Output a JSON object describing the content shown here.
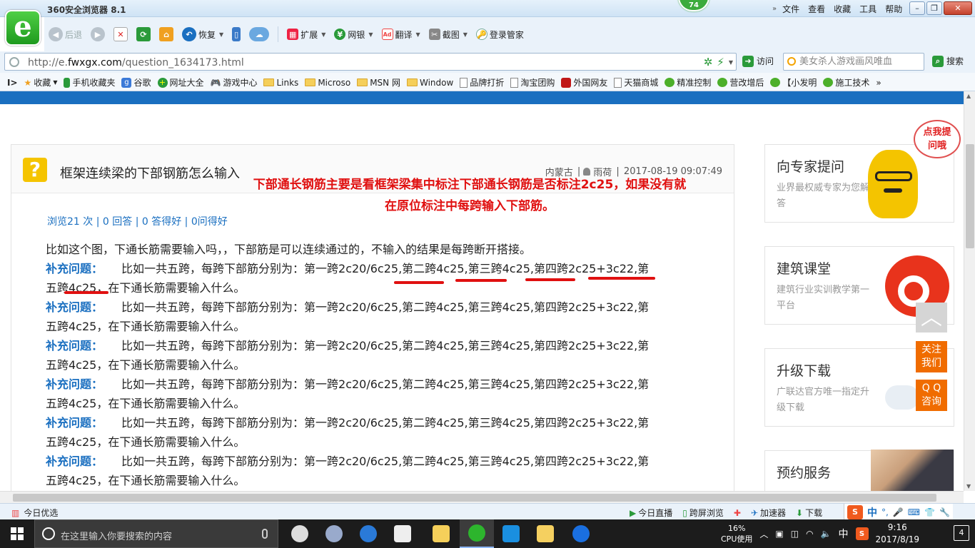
{
  "browser": {
    "title": "360安全浏览器 8.1",
    "badge": "74",
    "menu": [
      "文件",
      "查看",
      "收藏",
      "工具",
      "帮助"
    ],
    "logo_glyph": "e"
  },
  "toolbar": {
    "back": "后退",
    "restore": "恢复",
    "extend": "扩展",
    "netbank": "网银",
    "translate": "翻译",
    "screenshot": "截图",
    "login": "登录管家"
  },
  "address": {
    "url_prefix": "http://e.",
    "url_domain": "fwxgx.com",
    "url_path": "/question_1634173.html",
    "visit": "访问",
    "search_placeholder": "美女杀人游戏画风唯血",
    "search_button": "搜索"
  },
  "favorites": [
    "收藏",
    "手机收藏夹",
    "谷歌",
    "网址大全",
    "游戏中心",
    "Links",
    "Microso",
    "MSN 网",
    "Window",
    "品牌打折",
    "淘宝团购",
    "外国网友",
    "天猫商城",
    "精准控制",
    "营改增后",
    "【小发明",
    "施工技术"
  ],
  "question": {
    "icon": "?",
    "title": "框架连续梁的下部钢筋怎么输入",
    "region": "内蒙古",
    "author": "雨荷",
    "datetime": "2017-08-19 09:07:49",
    "stats": "浏览21 次 | 0 回答 | 0 答得好 | 0问得好",
    "body": "比如这个图，下通长筋需要输入吗，，下部筋是可以连续通过的，不输入的结果是每跨断开搭接。",
    "supplement_label": "补充问题：",
    "supplement_line1": "比如一共五跨，每跨下部筋分别为：第一跨2c20/6c25,第二跨4c25,第三跨4c25,第四跨2c25+3c22,第",
    "supplement_line2": "五跨4c25，在下通长筋需要输入什么。",
    "annotation_line1": "下部通长钢筋主要是看框架梁集中标注下部通长钢筋是否标注2c25，如果没有就",
    "annotation_line2": "在原位标注中每跨输入下部筋。"
  },
  "sidebar": {
    "expert_title": "向专家提问",
    "expert_sub": "业界最权威专家为您解答",
    "speech": "点我提问哦",
    "class_title": "建筑课堂",
    "class_sub": "建筑行业实训教学第一平台",
    "upgrade_title": "升级下载",
    "upgrade_sub": "广联达官方唯一指定升级下载",
    "booking_title": "预约服务",
    "follow": "关注我们",
    "qq": "Q Q咨询"
  },
  "statusbar": {
    "today": "今日优选",
    "live": "今日直播",
    "screen": "跨屏浏览",
    "accel": "加速器",
    "download": "下载",
    "ime": "中"
  },
  "taskbar": {
    "search_placeholder": "在这里输入你要搜索的内容",
    "cpu_value": "16%",
    "cpu_label": "CPU使用",
    "ime": "中",
    "time": "9:16",
    "date": "2017/8/19",
    "notifications": "4"
  },
  "colors": {
    "accent_blue": "#1a6fc0",
    "annotation_red": "#e01010",
    "browser_green": "#2db52d",
    "orange_button": "#f06c00"
  }
}
